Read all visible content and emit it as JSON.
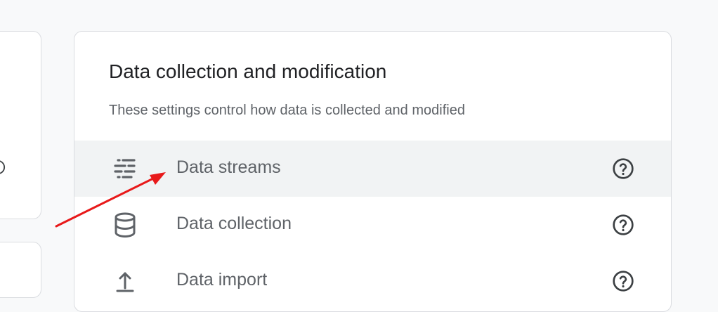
{
  "section": {
    "title": "Data collection and modification",
    "subtitle": "These settings control how data is collected and modified",
    "items": [
      {
        "label": "Data streams",
        "icon": "data-streams-icon",
        "selected": true
      },
      {
        "label": "Data collection",
        "icon": "database-icon",
        "selected": false
      },
      {
        "label": "Data import",
        "icon": "upload-icon",
        "selected": false
      }
    ]
  },
  "colors": {
    "background": "#f8f9fa",
    "card": "#ffffff",
    "border": "#dadce0",
    "selected_row": "#f1f3f4",
    "text_primary": "#202124",
    "text_secondary": "#5f6368",
    "annotation_arrow": "#e8191a"
  }
}
